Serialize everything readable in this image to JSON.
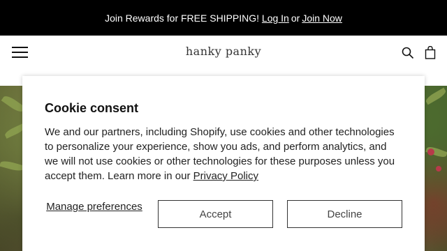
{
  "promo": {
    "text": "Join Rewards for FREE SHIPPING!",
    "login_label": "Log In",
    "or_text": "or",
    "join_label": "Join Now"
  },
  "header": {
    "logo_text": "hanky panky",
    "icons": [
      "hamburger-menu-icon",
      "search-icon",
      "shopping-bag-icon"
    ]
  },
  "cookie": {
    "title": "Cookie consent",
    "body": "We and our partners, including Shopify, use cookies and other technologies to personalize your experience, show you ads, and perform analytics, and we will not use cookies or other technologies for these purposes unless you accept them. Learn more in our",
    "privacy_link": "Privacy Policy",
    "manage_label": "Manage preferences",
    "accept_label": "Accept",
    "decline_label": "Decline"
  },
  "colors": {
    "promo_bg": "#000000",
    "promo_text": "#ffffff",
    "button_border": "#333333"
  }
}
